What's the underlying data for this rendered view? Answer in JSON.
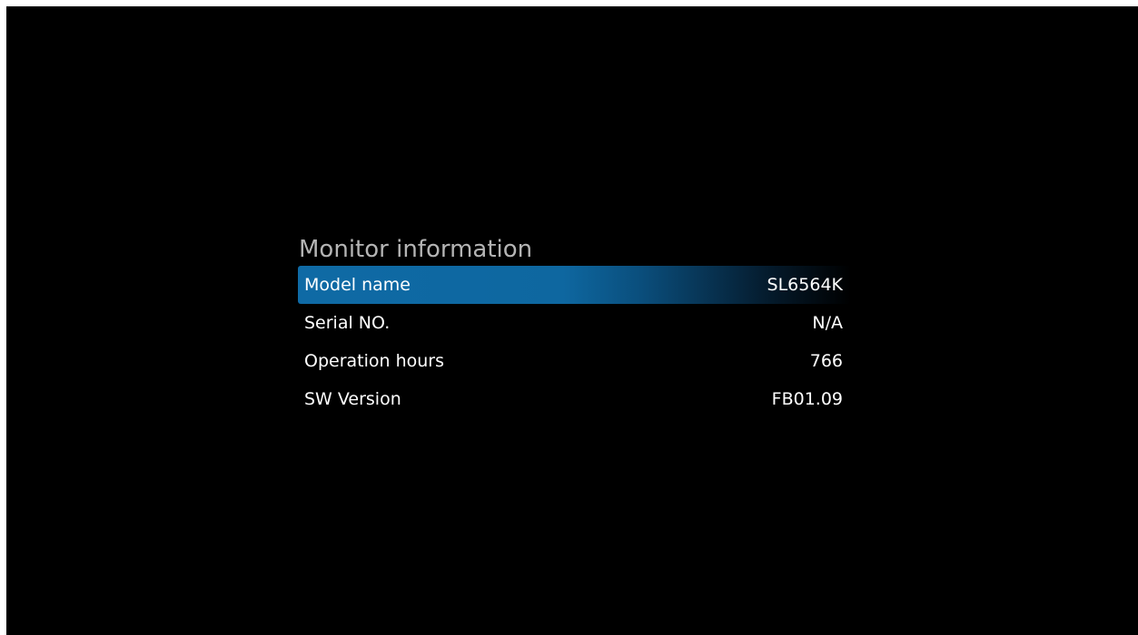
{
  "panel": {
    "title": "Monitor information",
    "rows": [
      {
        "label": "Model name",
        "value": "SL6564K",
        "selected": true
      },
      {
        "label": "Serial NO.",
        "value": "N/A",
        "selected": false
      },
      {
        "label": "Operation hours",
        "value": "766",
        "selected": false
      },
      {
        "label": "SW Version",
        "value": "FB01.09",
        "selected": false
      }
    ]
  },
  "colors": {
    "background": "#000000",
    "selection_accent": "#0f6aa5",
    "title_text": "#b4b4b4",
    "row_text": "#ffffff"
  }
}
